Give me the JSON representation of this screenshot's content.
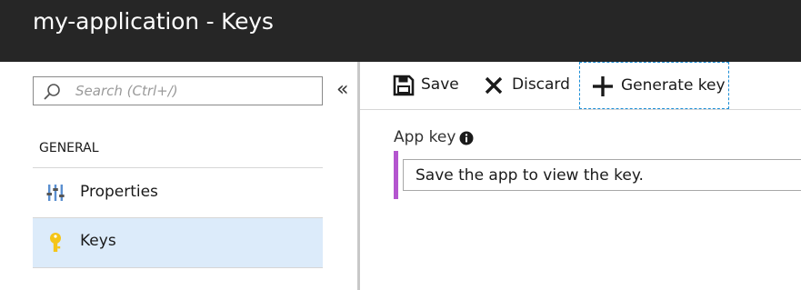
{
  "window": {
    "title": "my-application - Keys"
  },
  "sidebar": {
    "search_placeholder": "Search (Ctrl+/)",
    "collapse_glyph": "«",
    "section_heading": "GENERAL",
    "items": [
      {
        "label": "Properties",
        "icon": "properties-sliders-icon",
        "selected": false
      },
      {
        "label": "Keys",
        "icon": "key-icon",
        "selected": true
      }
    ]
  },
  "toolbar": {
    "save_label": "Save",
    "discard_label": "Discard",
    "generate_label": "Generate key"
  },
  "main": {
    "field_label": "App key",
    "key_value": "Save the app to view the key."
  },
  "colors": {
    "titlebar_bg": "#262626",
    "selected_item_bg": "#dcebfa",
    "field_accent": "#b455cf",
    "key_icon": "#f5c518",
    "focus_outline": "#1a8dd6"
  }
}
